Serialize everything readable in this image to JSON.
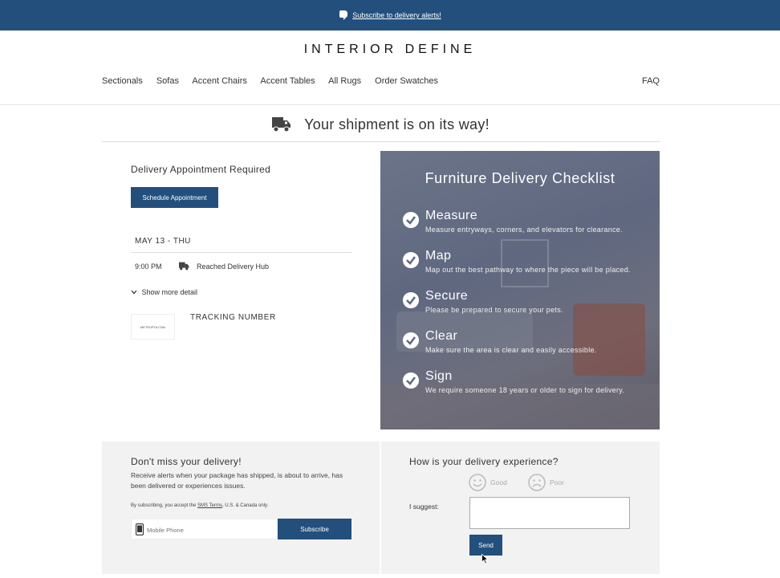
{
  "banner": {
    "text": "Subscribe to delivery alerts!",
    "icon": "bell-icon"
  },
  "brand": {
    "logo": "INTERIOR DEFINE"
  },
  "nav": {
    "items": [
      "Sectionals",
      "Sofas",
      "Accent Chairs",
      "Accent Tables",
      "All Rugs",
      "Order Swatches"
    ],
    "faq": "FAQ"
  },
  "shipment": {
    "title": "Your shipment is on its way!",
    "icon": "truck-icon"
  },
  "delivery": {
    "heading": "Delivery Appointment Required",
    "schedule_button": "Schedule Appointment",
    "date": "MAY 13 - THU",
    "event_time": "9:00 PM",
    "event_label": "Reached Delivery Hub",
    "show_more": "Show more detail",
    "tracking_label": "TRACKING NUMBER",
    "carrier_logo_text": "METROPOLITAN"
  },
  "checklist": {
    "title": "Furniture Delivery Checklist",
    "items": [
      {
        "title": "Measure",
        "desc": "Measure entryways, corners, and elevators for clearance."
      },
      {
        "title": "Map",
        "desc": "Map out the best pathway to where the piece will be placed."
      },
      {
        "title": "Secure",
        "desc": "Please be prepared to secure your pets."
      },
      {
        "title": "Clear",
        "desc": "Make sure the area is clear and easily accessible."
      },
      {
        "title": "Sign",
        "desc": "We require someone 18 years or older to sign for delivery."
      }
    ]
  },
  "alerts": {
    "title": "Don't miss your delivery!",
    "text": "Receive alerts when your package has shipped, is about to arrive, has been delivered or experiences issues.",
    "terms_prefix": "By subscribing, you accept the ",
    "terms_link": "SMS Terms",
    "terms_suffix": ", U.S. & Canada only.",
    "phone_placeholder": "Mobile Phone",
    "subscribe_button": "Subscribe"
  },
  "feedback": {
    "title": "How is your delivery experience?",
    "good": "Good",
    "poor": "Poor",
    "suggest_label": "I suggest:",
    "send_button": "Send"
  },
  "colors": {
    "brand_blue": "#234f7d"
  }
}
